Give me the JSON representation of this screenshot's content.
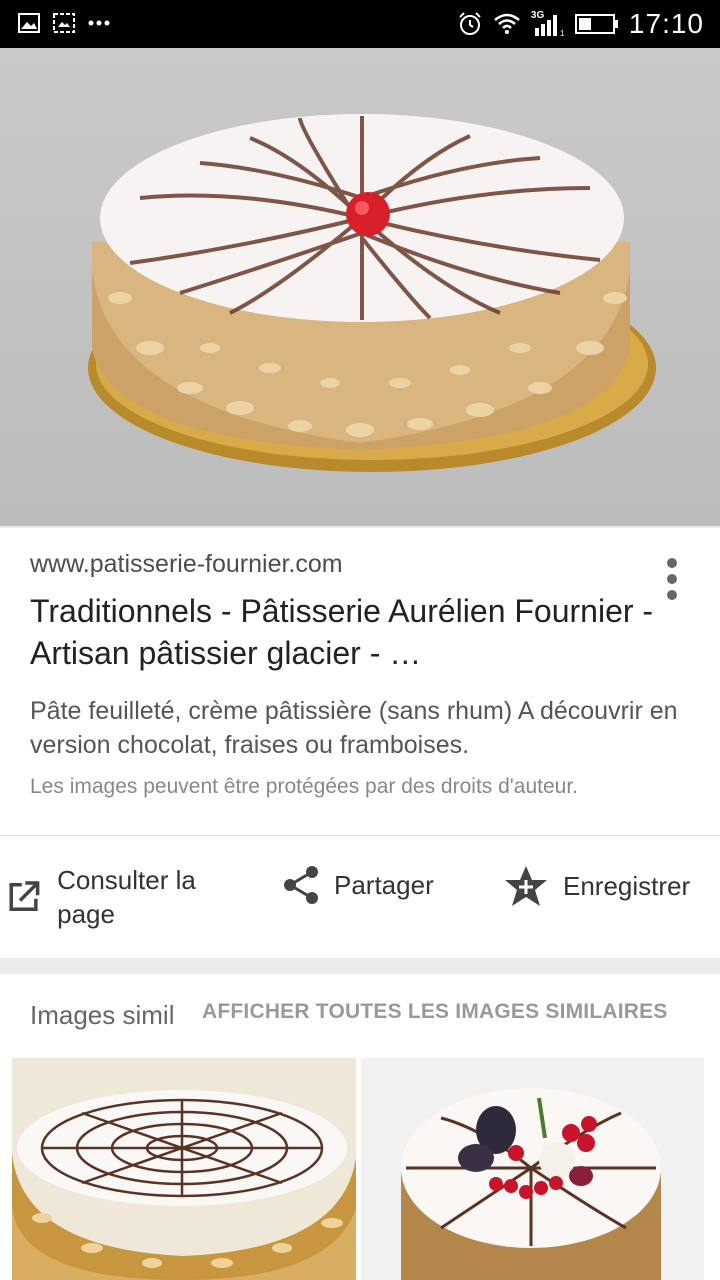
{
  "status_bar": {
    "time": "17:10",
    "network": "3G",
    "left_icons": [
      "image-icon",
      "screenshot-icon",
      "more-dots-icon"
    ],
    "right_icons": [
      "alarm-icon",
      "wifi-icon",
      "signal-icon",
      "battery-icon"
    ]
  },
  "result": {
    "domain": "www.patisserie-fournier.com",
    "title": "Traditionnels - Pâtisserie Aurélien Fournier - Artisan pâtissier glacier - …",
    "description": "Pâte feuilleté, crème pâtissière (sans rhum) A découvrir en version chocolat, fraises ou framboises.",
    "copyright": "Les images peuvent être protégées par des droits d'auteur."
  },
  "actions": {
    "open_label": "Consulter la page",
    "share_label": "Partager",
    "save_label": "Enregistrer"
  },
  "similar": {
    "title": "Images similaires",
    "show_all": "AFFICHER TOUTES LES IMAGES SIMILAIRES"
  },
  "colors": {
    "status_bar": "#000000",
    "page_background": "#ececec",
    "title_text": "#222222",
    "secondary_text": "#555555",
    "muted_text": "#999999"
  }
}
